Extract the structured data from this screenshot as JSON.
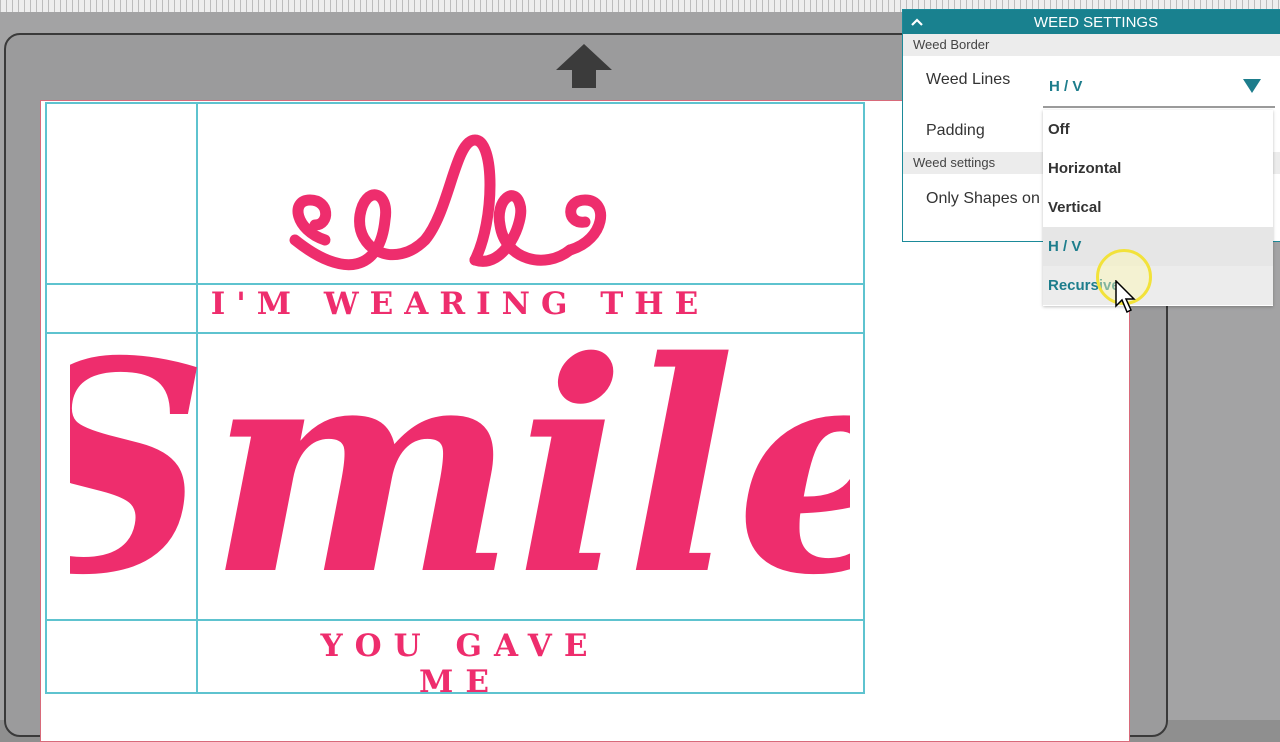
{
  "canvas": {
    "design": {
      "flourish_icon": "swirl-flourish",
      "line_top": "I'M WEARING THE",
      "line_main": "Smile",
      "line_bottom": "YOU GAVE ME",
      "color": "#ee2d6d"
    },
    "feed_arrow_icon": "up-arrow-icon",
    "guide_color": "#5ec3cf"
  },
  "weed_panel": {
    "title": "WEED SETTINGS",
    "collapse_icon": "chevron-up-icon",
    "section_border": "Weed Border",
    "weed_lines_label": "Weed Lines",
    "weed_lines_value": "H / V",
    "padding_label": "Padding",
    "section_settings": "Weed settings",
    "only_shapes_label": "Only Shapes on",
    "dropdown_options": [
      "Off",
      "Horizontal",
      "Vertical",
      "H / V",
      "Recursive"
    ],
    "selected_option": "H / V",
    "hovered_option": "Recursive",
    "accent": "#19818f"
  }
}
